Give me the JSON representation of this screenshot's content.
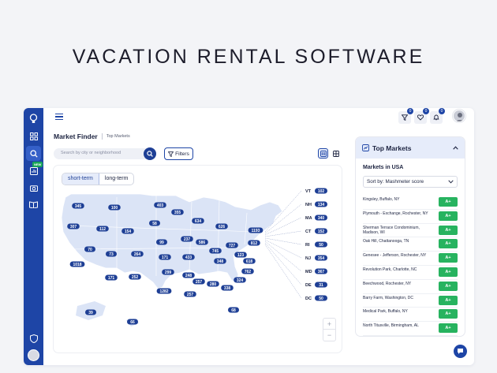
{
  "headline": "VACATION RENTAL SOFTWARE",
  "header": {
    "title": "Market Finder",
    "breadcrumb": "Top Markets",
    "notifications": [
      {
        "icon": "filter-icon",
        "count": "0"
      },
      {
        "icon": "heart-icon",
        "count": "0"
      },
      {
        "icon": "bell-icon",
        "count": "0"
      }
    ]
  },
  "sidebar": {
    "items": [
      {
        "icon": "lightbulb-logo-icon"
      },
      {
        "icon": "grid-icon"
      },
      {
        "icon": "search-icon",
        "active": true
      },
      {
        "icon": "chart-icon",
        "badge": "NEW"
      },
      {
        "icon": "camera-icon"
      },
      {
        "icon": "book-icon"
      },
      {
        "icon": "shield-icon"
      }
    ]
  },
  "search": {
    "placeholder": "Search by city or neighborhood"
  },
  "filters": {
    "label": "Filters"
  },
  "rental_type": {
    "options": [
      "short-term",
      "long-term"
    ],
    "selected": "short-term"
  },
  "map": {
    "zoom_in": "+",
    "zoom_out": "−",
    "region_counts": [
      "345",
      "100",
      "403",
      "307",
      "355",
      "634",
      "112",
      "154",
      "58",
      "626",
      "237",
      "586",
      "1193",
      "99",
      "727",
      "812",
      "70",
      "73",
      "264",
      "171",
      "433",
      "745",
      "123",
      "1018",
      "348",
      "618",
      "299",
      "762",
      "171",
      "252",
      "248",
      "324",
      "1282",
      "257",
      "280",
      "338",
      "257",
      "68",
      "39",
      "66"
    ],
    "east_states": [
      {
        "abbr": "VT",
        "count": "102"
      },
      {
        "abbr": "NH",
        "count": "134"
      },
      {
        "abbr": "MA",
        "count": "340"
      },
      {
        "abbr": "CT",
        "count": "152"
      },
      {
        "abbr": "RI",
        "count": "50"
      },
      {
        "abbr": "NJ",
        "count": "354"
      },
      {
        "abbr": "MD",
        "count": "367"
      },
      {
        "abbr": "DE",
        "count": "31"
      },
      {
        "abbr": "DC",
        "count": "50"
      }
    ]
  },
  "top_markets": {
    "title": "Top Markets",
    "subtitle": "Markets in USA",
    "sort_label": "Sort by: Mashmeter score",
    "markets": [
      {
        "name": "Kingsley, Buffalo, NY",
        "grade": "A+"
      },
      {
        "name": "Plymouth - Exchange, Rochester, NY",
        "grade": "A+"
      },
      {
        "name": "Sherman Terrace Condominium, Madison, WI",
        "grade": "A+"
      },
      {
        "name": "Oak Hill, Chattanooga, TN",
        "grade": "A+"
      },
      {
        "name": "Genesee - Jefferson, Rochester, NY",
        "grade": "A+"
      },
      {
        "name": "Revolution Park, Charlotte, NC",
        "grade": "A+"
      },
      {
        "name": "Beechwood, Rochester, NY",
        "grade": "A+"
      },
      {
        "name": "Barry Farm, Washington, DC",
        "grade": "A+"
      },
      {
        "name": "Medical Park, Buffalo, NY",
        "grade": "A+"
      },
      {
        "name": "North Titusville, Birmingham, AL",
        "grade": "A+"
      }
    ]
  },
  "colors": {
    "brand": "#1e45a6",
    "grade": "#27b35f",
    "map_fill": "#dbe4f6",
    "pill": "#1e3f95"
  }
}
